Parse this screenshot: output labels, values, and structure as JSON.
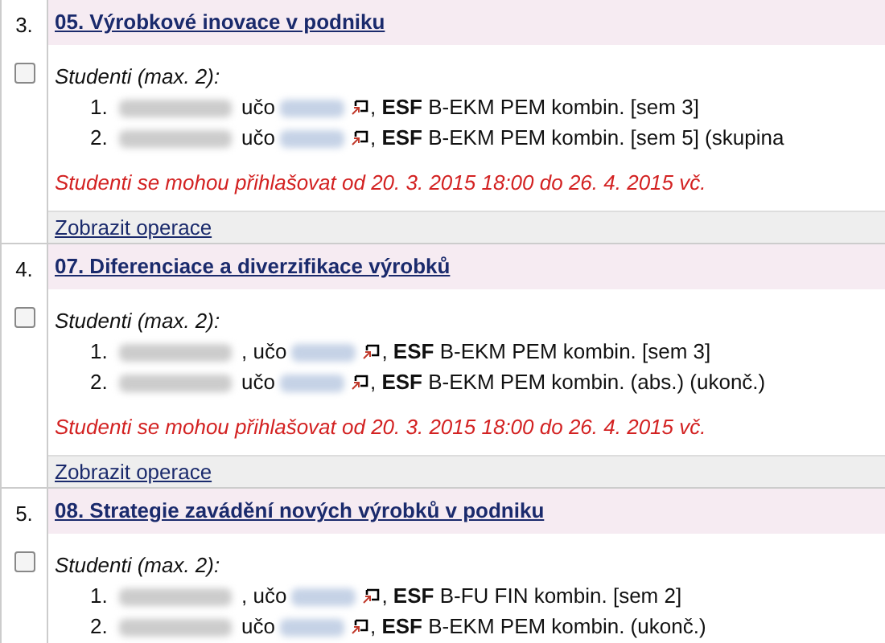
{
  "topics": [
    {
      "number": "3.",
      "title": "05. Výrobkové inovace v podniku",
      "checked": false,
      "students_label": "Studenti (max. 2):",
      "students": [
        {
          "number": "1.",
          "uco_label": "učo",
          "detail": ", **ESF** B-EKM PEM kombin. [sem 3]"
        },
        {
          "number": "2.",
          "uco_label": "učo",
          "detail": ", **ESF** B-EKM PEM kombin. [sem 5] (skupina"
        }
      ],
      "notice": "Studenti se mohou přihlašovat od 20. 3. 2015 18:00 do 26. 4. 2015 vč.",
      "operations": "Zobrazit operace"
    },
    {
      "number": "4.",
      "title": "07. Diferenciace a diverzifikace výrobků",
      "checked": false,
      "students_label": "Studenti (max. 2):",
      "students": [
        {
          "number": "1.",
          "uco_label": ", učo",
          "detail": ", **ESF** B-EKM PEM kombin. [sem 3]"
        },
        {
          "number": "2.",
          "uco_label": "učo",
          "detail": ", **ESF** B-EKM PEM kombin. (abs.) (ukonč.)"
        }
      ],
      "notice": "Studenti se mohou přihlašovat od 20. 3. 2015 18:00 do 26. 4. 2015 vč.",
      "operations": "Zobrazit operace"
    },
    {
      "number": "5.",
      "title": "08. Strategie zavádění nových výrobků v podniku",
      "checked": false,
      "students_label": "Studenti (max. 2):",
      "students": [
        {
          "number": "1.",
          "uco_label": ", učo",
          "detail": ", **ESF** B-FU FIN kombin. [sem 2]"
        },
        {
          "number": "2.",
          "uco_label": "učo",
          "detail": ", **ESF** B-EKM PEM kombin. (ukonč.)"
        }
      ]
    }
  ]
}
